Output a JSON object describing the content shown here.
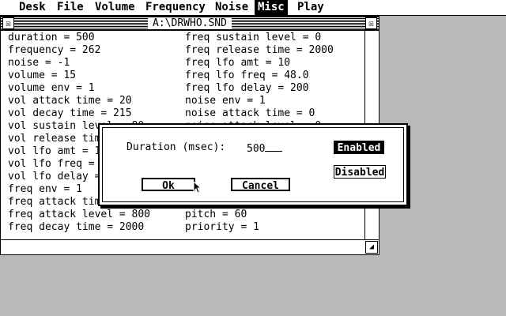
{
  "menubar": {
    "items": [
      {
        "label": "Desk",
        "active": false
      },
      {
        "label": "File",
        "active": false
      },
      {
        "label": "Volume",
        "active": false
      },
      {
        "label": "Frequency",
        "active": false
      },
      {
        "label": "Noise",
        "active": false
      },
      {
        "label": "Misc",
        "active": true
      },
      {
        "label": "Play",
        "active": false
      }
    ]
  },
  "window": {
    "title": "A:\\DRWHO.SND",
    "close_glyph": "☒",
    "full_glyph": "☒",
    "size_glyph": "◢",
    "left_column": [
      "duration = 500",
      "frequency = 262",
      "noise = -1",
      "volume = 15",
      "volume env = 1",
      "vol attack time = 20",
      "vol decay time = 215",
      "vol sustain level = 80",
      "vol release tim",
      "vol lfo amt = 1",
      "vol lfo freq =",
      "vol lfo delay =",
      "freq env = 1",
      "freq attack tim",
      "freq attack level = 800",
      "freq decay time = 2000"
    ],
    "right_column": [
      "freq sustain level = 0",
      "freq release time = 2000",
      "freq lfo amt = 10",
      "freq lfo freq = 48.0",
      "freq lfo delay = 200",
      "noise env = 1",
      "noise attack time = 0",
      "noise attack level = 0",
      "",
      "",
      "",
      "",
      "",
      "",
      "pitch = 60",
      "priority = 1"
    ]
  },
  "dialog": {
    "label": "Duration (msec):",
    "value": "500",
    "enabled_label": "Enabled",
    "disabled_label": "Disabled",
    "ok_label": "Ok",
    "cancel_label": "Cancel"
  }
}
